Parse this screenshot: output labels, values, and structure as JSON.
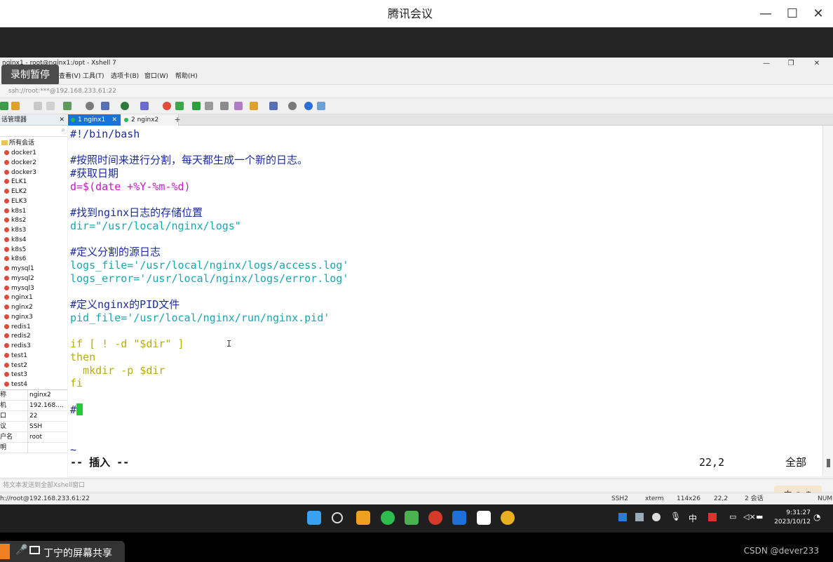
{
  "meeting": {
    "title": "腾讯会议"
  },
  "xshell": {
    "title": "nginx1 - root@nginx1:/opt - Xshell 7",
    "record_badge": "录制暂停",
    "menu": [
      "查看(V)",
      "工具(T)",
      "选项卡(B)",
      "窗口(W)",
      "帮助(H)"
    ],
    "address": "ssh://root:***@192.168.233.61:22",
    "session_manager_title": "话管理器",
    "tree_root": "所有会话",
    "sessions": [
      "docker1",
      "docker2",
      "docker3",
      "ELK1",
      "ELK2",
      "ELK3",
      "k8s1",
      "k8s2",
      "k8s3",
      "k8s4",
      "k8s5",
      "k8s6",
      "mysql1",
      "mysql2",
      "mysql3",
      "nginx1",
      "nginx2",
      "nginx3",
      "redis1",
      "redis2",
      "redis3",
      "test1",
      "test2",
      "test3",
      "test4"
    ],
    "props": [
      {
        "k": "称",
        "v": "nginx2"
      },
      {
        "k": "机",
        "v": "192.168...."
      },
      {
        "k": "口",
        "v": "22"
      },
      {
        "k": "议",
        "v": "SSH"
      },
      {
        "k": "户名",
        "v": "root"
      },
      {
        "k": "明",
        "v": ""
      }
    ],
    "tabs": [
      {
        "label": "1 nginx1"
      },
      {
        "label": "2 nginx2"
      }
    ],
    "input_bar": "将文本发送到全部Xshell窗口",
    "status": {
      "left": "h://root@192.168.233.61:22",
      "ssh": "SSH2",
      "term": "xterm",
      "size": "114x26",
      "pos": "22,2",
      "sessions": "2 会话",
      "caps": "NUM"
    },
    "ime": "中"
  },
  "terminal": {
    "lines": [
      {
        "text": "#!/bin/bash",
        "color": "#1b2c9b"
      },
      {
        "text": "",
        "color": ""
      },
      {
        "text": "#按照时间来进行分割，每天都生成一个新的日志。",
        "color": "#1b2c9b"
      },
      {
        "text": "#获取日期",
        "color": "#1b2c9b"
      },
      {
        "text": "d=$(date +%Y-%m-%d)",
        "color": "#c21bc2"
      },
      {
        "text": "",
        "color": ""
      },
      {
        "text": "#找到nginx日志的存储位置",
        "color": "#1b2c9b"
      },
      {
        "text": "dir=\"/usr/local/nginx/logs\"",
        "color": "#1aa6b0"
      },
      {
        "text": "",
        "color": ""
      },
      {
        "text": "#定义分割的源日志",
        "color": "#1b2c9b"
      },
      {
        "text": "logs_file='/usr/local/nginx/logs/access.log'",
        "color": "#1aa6b0"
      },
      {
        "text": "logs_error='/usr/local/nginx/logs/error.log'",
        "color": "#1aa6b0"
      },
      {
        "text": "",
        "color": ""
      },
      {
        "text": "#定义nginx的PID文件",
        "color": "#1b2c9b"
      },
      {
        "text": "pid_file='/usr/local/nginx/run/nginx.pid'",
        "color": "#1aa6b0"
      },
      {
        "text": "",
        "color": ""
      },
      {
        "text": "if [ ! -d \"$dir\" ]",
        "color": "#b8b000"
      },
      {
        "text": "then",
        "color": "#b8b000"
      },
      {
        "text": "  mkdir -p $dir",
        "color": "#b8b000"
      },
      {
        "text": "fi",
        "color": "#b8b000"
      },
      {
        "text": "",
        "color": ""
      },
      {
        "text": "#",
        "color": "#1b2c9b"
      }
    ],
    "tilde": "~",
    "mode": "-- 插入 --",
    "position": "22,2",
    "scope": "全部"
  },
  "taskbar": {
    "time": "9:31:27",
    "date": "2023/10/12",
    "ime": "中"
  },
  "share": {
    "label": "丁宁的屏幕共享",
    "watermark": "CSDN @dever233"
  }
}
